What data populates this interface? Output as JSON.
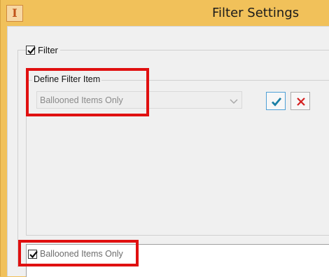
{
  "window": {
    "title": "Filter Settings",
    "app_icon_glyph": "I",
    "accent_color": "#f1c15a"
  },
  "filter_group": {
    "enabled_label": "Filter",
    "enabled_checked": true
  },
  "define_filter": {
    "title": "Define Filter Item",
    "select_value": "Ballooned Items Only",
    "ok_icon": "checkmark-icon",
    "cancel_icon": "close-icon"
  },
  "filter_list": {
    "items": [
      {
        "label": "Ballooned Items Only",
        "checked": true
      }
    ]
  },
  "highlight_color": "#e01010"
}
